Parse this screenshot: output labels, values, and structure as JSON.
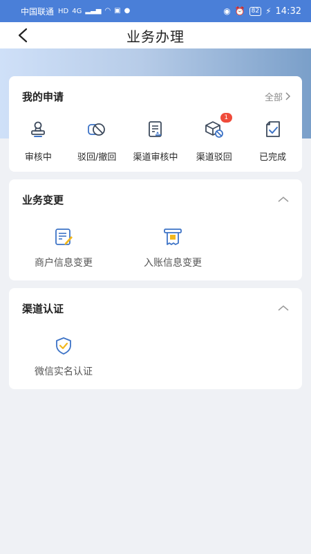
{
  "status_bar": {
    "carrier": "中国联通",
    "network": "HD",
    "signal": "4G",
    "battery": "82",
    "time": "14:32"
  },
  "nav": {
    "title": "业务办理"
  },
  "applications": {
    "title": "我的申请",
    "view_all": "全部",
    "items": [
      {
        "label": "审核中",
        "icon": "stamp-icon"
      },
      {
        "label": "驳回/撤回",
        "icon": "prohibited-icon"
      },
      {
        "label": "渠道审核中",
        "icon": "document-review-icon"
      },
      {
        "label": "渠道驳回",
        "icon": "box-rejected-icon",
        "badge": "1"
      },
      {
        "label": "已完成",
        "icon": "check-document-icon"
      }
    ]
  },
  "business_change": {
    "title": "业务变更",
    "items": [
      {
        "label": "商户信息变更",
        "icon": "edit-document-icon"
      },
      {
        "label": "入账信息变更",
        "icon": "receipt-icon"
      }
    ]
  },
  "channel_auth": {
    "title": "渠道认证",
    "items": [
      {
        "label": "微信实名认证",
        "icon": "shield-check-icon"
      }
    ]
  },
  "colors": {
    "accent": "#3d73c6",
    "badge": "#ef4b3a",
    "icon_yellow": "#f2b81e"
  }
}
